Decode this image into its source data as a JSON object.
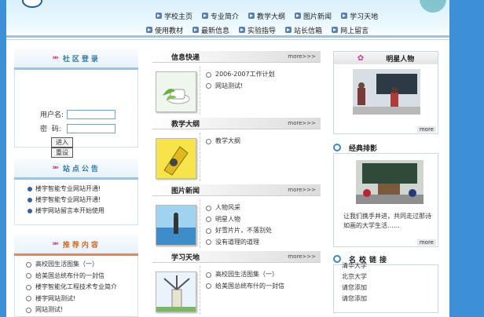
{
  "nav": {
    "row1": [
      "学校主页",
      "专业简介",
      "教学大纲",
      "图片新闻",
      "学习天地"
    ],
    "row2": [
      "使用教材",
      "最新信息",
      "实验指导",
      "站长信箱",
      "网上留言"
    ]
  },
  "login": {
    "title": "社区登录",
    "username_label": "用户名:",
    "password_label": "密  码:",
    "login_button": "进入",
    "reset_button": "重设"
  },
  "notice": {
    "title": "站点公告",
    "items": [
      "楼宇智能专业网站开通!",
      "楼宇智能专业网站开通!",
      "楼宇网站留言本开始使用"
    ]
  },
  "recommend": {
    "title": "推荐内容",
    "items": [
      "高校园生活图集（一）",
      "给美国总统布什的一封信",
      "楼宇智能化工程技术专业简介",
      "楼宇网站测试!",
      "网站测试!"
    ]
  },
  "sections": [
    {
      "title": "信息快递",
      "more": "more>>>",
      "items": [
        "2006-2007工作计划",
        "网站测试!"
      ]
    },
    {
      "title": "教学大纲",
      "more": "more>>>",
      "items": [
        "教学大纲"
      ]
    },
    {
      "title": "图片新闻",
      "more": "more>>>",
      "items": [
        "人物风采",
        "明星人物",
        "好雪片片，不落别处",
        "没有道理的道理"
      ]
    },
    {
      "title": "学习天地",
      "more": "more>>>",
      "items": [
        "高校园生活图集（一）",
        "给美国总统布什的一封信"
      ]
    }
  ],
  "star": {
    "title": "明星人物",
    "more": "more"
  },
  "classic": {
    "title": "经典排影",
    "caption": "让我们携手并进，共同走过那诗如画的大学生活……",
    "more": "more"
  },
  "schools": {
    "title": "名校链接",
    "items": [
      "清华大学",
      "北京大学",
      "请您添加",
      "请您添加"
    ]
  },
  "colors": {
    "background": "#3d8fd8",
    "accent": "#2d7aa8",
    "nav_line": "#9fc5dd",
    "rec_line": "#e8864e"
  }
}
